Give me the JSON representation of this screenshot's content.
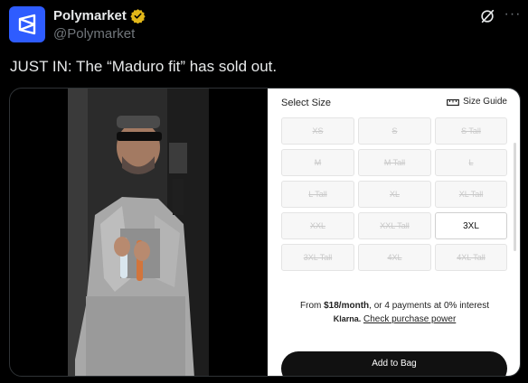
{
  "account": {
    "display_name": "Polymarket",
    "handle": "@Polymarket"
  },
  "post": {
    "text": "JUST IN: The “Maduro fit” has sold out."
  },
  "product_panel": {
    "select_size_label": "Select Size",
    "size_guide_label": "Size Guide",
    "sizes": [
      {
        "label": "XS",
        "available": false
      },
      {
        "label": "S",
        "available": false
      },
      {
        "label": "S Tall",
        "available": false
      },
      {
        "label": "M",
        "available": false
      },
      {
        "label": "M Tall",
        "available": false
      },
      {
        "label": "L",
        "available": false
      },
      {
        "label": "L Tall",
        "available": false
      },
      {
        "label": "XL",
        "available": false
      },
      {
        "label": "XL Tall",
        "available": false
      },
      {
        "label": "XXL",
        "available": false
      },
      {
        "label": "XXL Tall",
        "available": false
      },
      {
        "label": "3XL",
        "available": true
      },
      {
        "label": "3XL Tall",
        "available": false
      },
      {
        "label": "4XL",
        "available": false
      },
      {
        "label": "4XL Tall",
        "available": false
      }
    ],
    "finance_prefix": "From ",
    "finance_price": "$18/month",
    "finance_suffix": ", or 4 payments at 0% interest",
    "klarna_label": "Klarna.",
    "klarna_link": "Check purchase power",
    "add_to_bag_label": "Add to Bag"
  },
  "colors": {
    "brand_blue": "#2e5cff",
    "verified_gold": "#e2b719",
    "background": "#000000"
  },
  "icons": [
    "polymarket-logo-icon",
    "verified-badge-icon",
    "grok-icon",
    "more-icon",
    "size-guide-icon"
  ]
}
